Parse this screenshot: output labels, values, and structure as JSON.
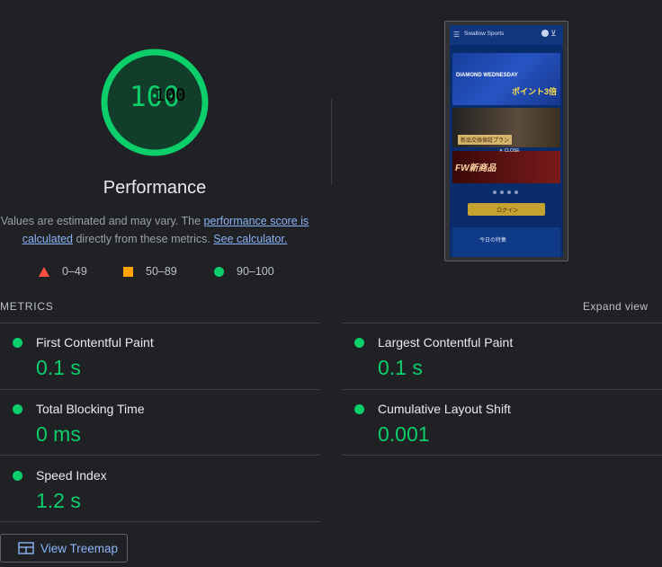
{
  "gauge": {
    "score": "100",
    "score_ghost": "100",
    "score_value": 100,
    "color": "#0cce6b"
  },
  "category_title": "Performance",
  "description": {
    "prefix": "Values are estimated and may vary. The ",
    "link1": "performance score is calculated",
    "middle": " directly from these metrics. ",
    "link2": "See calculator."
  },
  "legend": [
    {
      "shape": "triangle",
      "label": "0–49",
      "color": "#ff4e42"
    },
    {
      "shape": "square",
      "label": "50–89",
      "color": "#ffa400"
    },
    {
      "shape": "circle",
      "label": "90–100",
      "color": "#0cce6b"
    }
  ],
  "metrics_header": {
    "label": "METRICS",
    "expand": "Expand view"
  },
  "metrics": [
    {
      "name": "First Contentful Paint",
      "value": "0.1 s"
    },
    {
      "name": "Largest Contentful Paint",
      "value": "0.1 s"
    },
    {
      "name": "Total Blocking Time",
      "value": "0 ms"
    },
    {
      "name": "Cumulative Layout Shift",
      "value": "0.001"
    },
    {
      "name": "Speed Index",
      "value": "1.2 s"
    }
  ],
  "treemap_button": "View Treemap",
  "thumbnail": {
    "site": "Swallow Sports",
    "banner1_title": "DIAMOND WEDNESDAY",
    "banner1_points": "ポイント3倍",
    "banner2_text": "新品交換保証プラン",
    "banner3_text": "FW新商品",
    "close": "✕ CLOSE",
    "login": "ログイン",
    "footer": "今日の特集"
  }
}
